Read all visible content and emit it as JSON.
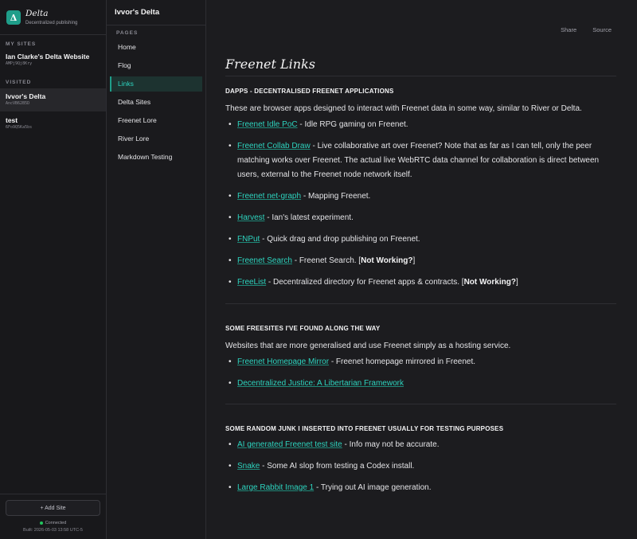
{
  "brand": {
    "logo": "Δ",
    "name": "Delta",
    "subtitle": "Decentralized publishing"
  },
  "sidebar": {
    "my_sites_label": "MY SITES",
    "my_sites": [
      {
        "name": "Ian Clarke's Delta Website",
        "key": "AMPj9Qj8Kry"
      }
    ],
    "visited_label": "VISITED",
    "visited": [
      {
        "name": "Ivvor's Delta",
        "key": "AncVB62B5D"
      },
      {
        "name": "test",
        "key": "6Fo9Q5Ka5bs"
      }
    ],
    "add_site": "+ Add Site",
    "status": "Connected",
    "build": "Built: 2026-05-03 13:58 UTC-5"
  },
  "pages": {
    "site_title": "Ivvor's Delta",
    "label": "PAGES",
    "items": [
      "Home",
      "Flog",
      "Links",
      "Delta Sites",
      "Freenet Lore",
      "River Lore",
      "Markdown Testing"
    ],
    "active": "Links"
  },
  "topbar": {
    "share": "Share",
    "source": "Source"
  },
  "article": {
    "title": "Freenet Links",
    "sections": [
      {
        "heading": "DAPPS - DECENTRALISED FREENET APPLICATIONS",
        "intro": "These are browser apps designed to interact with Freenet data in some way, similar to River or Delta.",
        "items": [
          {
            "link": "Freenet Idle PoC",
            "text": " - Idle RPG gaming on Freenet."
          },
          {
            "link": "Freenet Collab Draw",
            "text": " - Live collaborative art over Freenet? Note that as far as I can tell, only the peer matching works over Freenet. The actual live WebRTC data channel for collaboration is direct between users, external to the Freenet node network itself."
          },
          {
            "link": "Freenet net-graph",
            "text": " - Mapping Freenet."
          },
          {
            "link": "Harvest",
            "text": " - Ian's latest experiment."
          },
          {
            "link": "FNPut",
            "text": " - Quick drag and drop publishing on Freenet."
          },
          {
            "link": "Freenet Search",
            "text": " - Freenet Search. [",
            "bold": "Not Working?",
            "after": "]"
          },
          {
            "link": "FreeList",
            "text": " - Decentralized directory for Freenet apps & contracts. [",
            "bold": "Not Working?",
            "after": "]"
          }
        ]
      },
      {
        "heading": "SOME FREESITES I'VE FOUND ALONG THE WAY",
        "intro": "Websites that are more generalised and use Freenet simply as a hosting service.",
        "items": [
          {
            "link": "Freenet Homepage Mirror",
            "text": " - Freenet homepage mirrored in Freenet."
          },
          {
            "link": "Decentralized Justice: A Libertarian Framework",
            "text": ""
          }
        ]
      },
      {
        "heading": "SOME RANDOM JUNK I INSERTED INTO FREENET USUALLY FOR TESTING PURPOSES",
        "items": [
          {
            "link": "AI generated Freenet test site",
            "text": " - Info may not be accurate."
          },
          {
            "link": "Snake",
            "text": " - Some AI slop from testing a Codex install."
          },
          {
            "link": "Large Rabbit Image 1",
            "text": " - Trying out AI image generation."
          }
        ]
      }
    ]
  },
  "colors": {
    "accent": "#1f9e8a",
    "link": "#2dd4bf",
    "background": "#1c1c1f",
    "status": "#22c55e"
  }
}
